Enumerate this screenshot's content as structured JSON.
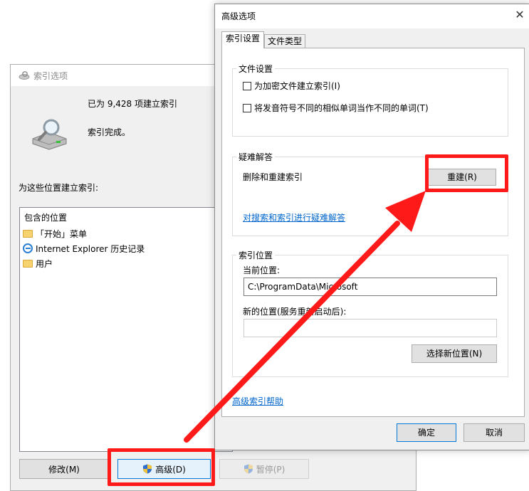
{
  "indexing_window": {
    "title": "索引选项",
    "status_count": "已为 9,428 项建立索引",
    "status_state": "索引完成。",
    "locations_label": "为这些位置建立索引:",
    "list_header": "包含的位置",
    "locations": [
      "「开始」菜单",
      "Internet Explorer 历史记录",
      "用户"
    ],
    "modify_button": "修改(M)",
    "advanced_button": "高级(D)",
    "pause_button": "暂停(P)"
  },
  "advanced_dialog": {
    "title": "高级选项",
    "close_glyph": "✕",
    "tabs": [
      "索引设置",
      "文件类型"
    ],
    "file_settings": {
      "legend": "文件设置",
      "encrypt_option": "为加密文件建立索引(I)",
      "diacritics_option": "将发音符号不同的相似单词当作不同的单词(T)"
    },
    "troubleshooting": {
      "legend": "疑难解答",
      "rebuild_label": "删除和重建索引",
      "rebuild_button": "重建(R)",
      "troubleshoot_link": "对搜索和索引进行疑难解答"
    },
    "index_location": {
      "legend": "索引位置",
      "current_label": "当前位置:",
      "current_value": "C:\\ProgramData\\Microsoft",
      "new_label": "新的位置(服务重新启动后):",
      "new_value": "",
      "select_button": "选择新位置(N)"
    },
    "help_link": "高级索引帮助",
    "ok_button": "确定",
    "cancel_button": "取消"
  },
  "colors": {
    "annotation_red": "#ff1a1a",
    "link_blue": "#0066cc",
    "dialog_bg": "#f0f0f0"
  }
}
